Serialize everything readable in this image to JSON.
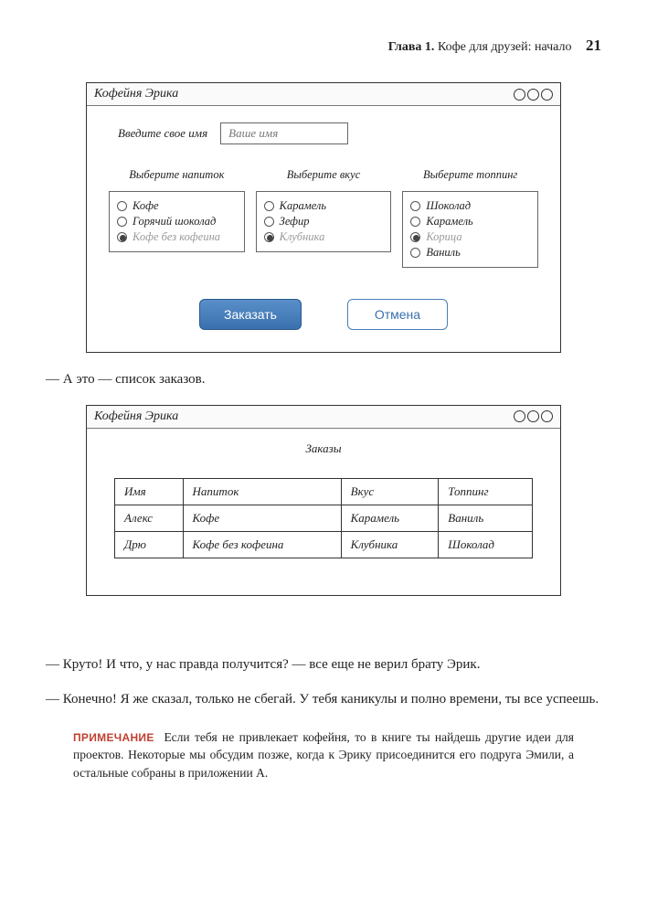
{
  "header": {
    "chapter_label": "Глава 1.",
    "chapter_title": " Кофе для друзей: начало",
    "page_number": "21"
  },
  "mockup1": {
    "title": "Кофейня Эрика",
    "name_label": "Введите свое имя",
    "name_placeholder": "Ваше имя",
    "col1_label": "Выберите напиток",
    "col2_label": "Выберите вкус",
    "col3_label": "Выберите топпинг",
    "drinks": [
      "Кофе",
      "Горячий шоколад",
      "Кофе без кофеина"
    ],
    "flavors": [
      "Карамель",
      "Зефир",
      "Клубника"
    ],
    "toppings": [
      "Шоколад",
      "Карамель",
      "Корица",
      "Ваниль"
    ],
    "btn_order": "Заказать",
    "btn_cancel": "Отмена"
  },
  "text1": "— А это — список заказов.",
  "mockup2": {
    "title": "Кофейня Эрика",
    "orders_title": "Заказы",
    "headers": [
      "Имя",
      "Напиток",
      "Вкус",
      "Топпинг"
    ],
    "rows": [
      [
        "Алекс",
        "Кофе",
        "Карамель",
        "Ваниль"
      ],
      [
        "Дрю",
        "Кофе без кофеина",
        "Клубника",
        "Шоколад"
      ]
    ]
  },
  "text2": "— Круто! И что, у нас правда получится? — все еще не верил брату Эрик.",
  "text3": "— Конечно! Я же сказал, только не сбегай. У тебя каникулы и полно времени, ты все успеешь.",
  "note": {
    "label": "ПРИМЕЧАНИЕ",
    "text": "Если тебя не привлекает кофейня, то в книге ты найдешь другие идеи для проектов. Некоторые мы обсудим позже, когда к Эрику присоединится его подруга Эмили, а остальные собраны в приложении А."
  }
}
